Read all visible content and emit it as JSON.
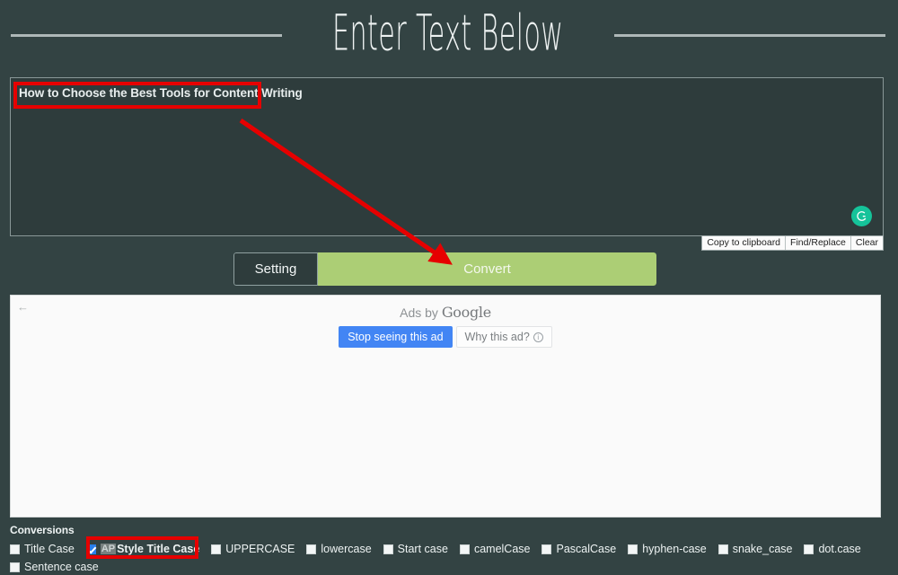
{
  "header": {
    "title": "Enter Text Below"
  },
  "editor": {
    "content": "How to Choose the Best Tools for Content Writing",
    "grammarly_icon": "grammarly-icon",
    "tools": [
      {
        "label": "Copy to clipboard",
        "name": "copy-to-clipboard-button"
      },
      {
        "label": "Find/Replace",
        "name": "find-replace-button"
      },
      {
        "label": "Clear",
        "name": "clear-button"
      }
    ]
  },
  "actions": {
    "setting_label": "Setting",
    "convert_label": "Convert"
  },
  "ad": {
    "back_icon": "back-arrow-icon",
    "back_glyph": "←",
    "ads_by_prefix": "Ads by ",
    "ads_by_brand": "Google",
    "stop_label": "Stop seeing this ad",
    "why_label": "Why this ad?",
    "info_glyph": "i"
  },
  "conversions": {
    "title": "Conversions",
    "items": [
      {
        "label": "Title Case",
        "checked": false,
        "badge": null
      },
      {
        "label": "Style Title Case",
        "checked": true,
        "badge": "AP"
      },
      {
        "label": "UPPERCASE",
        "checked": false,
        "badge": null
      },
      {
        "label": "lowercase",
        "checked": false,
        "badge": null
      },
      {
        "label": "Start case",
        "checked": false,
        "badge": null
      },
      {
        "label": "camelCase",
        "checked": false,
        "badge": null
      },
      {
        "label": "PascalCase",
        "checked": false,
        "badge": null
      },
      {
        "label": "hyphen-case",
        "checked": false,
        "badge": null
      },
      {
        "label": "snake_case",
        "checked": false,
        "badge": null
      },
      {
        "label": "dot.case",
        "checked": false,
        "badge": null
      },
      {
        "label": "Sentence case",
        "checked": false,
        "badge": null
      }
    ]
  },
  "colors": {
    "background": "#334343",
    "convert_button": "#acce75",
    "annotation_red": "#e60000",
    "checkbox_checked": "#2a7fea",
    "ad_button_blue": "#4285f4",
    "grammarly_green": "#15c39a"
  }
}
